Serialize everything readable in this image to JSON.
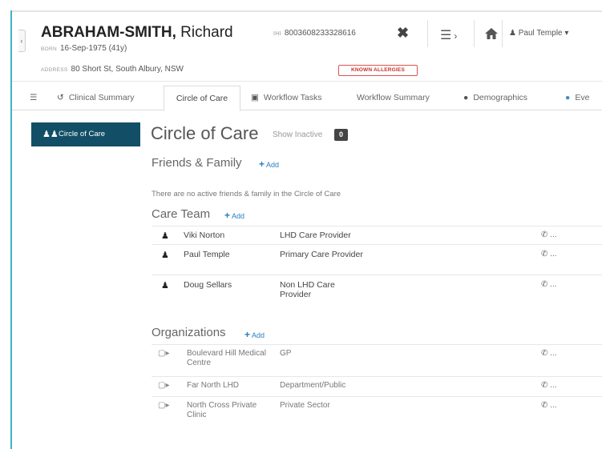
{
  "patient": {
    "surname": "ABRAHAM-SMITH,",
    "given_name": "Richard",
    "born_label": "BORN",
    "born_value": "16-Sep-1975 (41y)",
    "address_label": "ADDRESS",
    "address_value": "80 Short St, South Albury, NSW",
    "ihi_label": "IHI",
    "ihi_value": "8003608233328616",
    "allergy_badge": "KNOWN ALLERGIES"
  },
  "header": {
    "close_glyph": "✖",
    "user_name": "Paul Temple"
  },
  "tabs": [
    {
      "label": "Clinical Summary",
      "icon": "history-icon"
    },
    {
      "label": "Circle of Care",
      "icon": ""
    },
    {
      "label": "Workflow Tasks",
      "icon": "tasks-icon"
    },
    {
      "label": "Workflow Summary",
      "icon": ""
    },
    {
      "label": "Demographics",
      "icon": "pin-icon"
    },
    {
      "label": "Eve",
      "icon": "globe-icon"
    }
  ],
  "sidebar": {
    "active_item": "Circle of Care"
  },
  "main": {
    "title": "Circle of Care",
    "show_inactive_label": "Show Inactive",
    "show_inactive_count": "0",
    "friends": {
      "title": "Friends & Family",
      "add_label": "Add",
      "empty_text": "There are no active friends & family in the Circle of Care"
    },
    "care_team": {
      "title": "Care Team",
      "add_label": "Add",
      "members": [
        {
          "name": "Viki Norton",
          "role": "LHD Care Provider",
          "phone": "..."
        },
        {
          "name": "Paul Temple",
          "role": "Primary Care Provider",
          "phone": "..."
        },
        {
          "name": "Doug Sellars",
          "role": "Non LHD Care Provider",
          "phone": "..."
        }
      ]
    },
    "organizations": {
      "title": "Organizations",
      "add_label": "Add",
      "items": [
        {
          "name": "Boulevard Hill Medical Centre",
          "type": "GP",
          "phone": "..."
        },
        {
          "name": "Far North LHD",
          "type": "Department/Public",
          "phone": "..."
        },
        {
          "name": "North Cross Private Clinic",
          "type": "Private Sector",
          "phone": "..."
        }
      ]
    }
  }
}
